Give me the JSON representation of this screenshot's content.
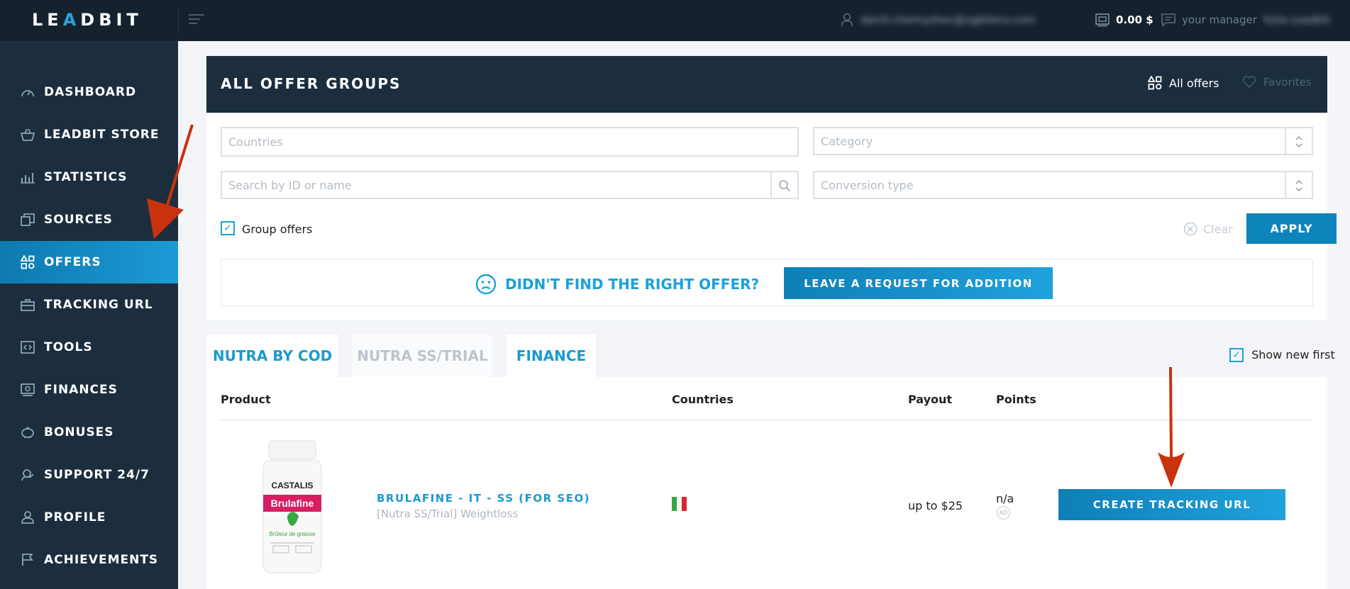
{
  "topbar": {
    "logo_left": "LE",
    "logo_accent": "A",
    "logo_right": "DBIT",
    "user_email": "daniil.chernyshev@xgbilenv.com",
    "balance": "0.00 $",
    "manager_label": "your manager",
    "manager_name": "Yulia Leadbit"
  },
  "sidebar": {
    "items": [
      {
        "label": "DASHBOARD",
        "icon": "gauge-icon"
      },
      {
        "label": "LEADBIT STORE",
        "icon": "basket-icon"
      },
      {
        "label": "STATISTICS",
        "icon": "bar-chart-icon"
      },
      {
        "label": "SOURCES",
        "icon": "layers-icon"
      },
      {
        "label": "OFFERS",
        "icon": "offers-icon"
      },
      {
        "label": "TRACKING URL",
        "icon": "briefcase-icon"
      },
      {
        "label": "TOOLS",
        "icon": "code-icon"
      },
      {
        "label": "FINANCES",
        "icon": "money-icon"
      },
      {
        "label": "BONUSES",
        "icon": "piggy-bank-icon"
      },
      {
        "label": "SUPPORT 24/7",
        "icon": "support-icon"
      },
      {
        "label": "PROFILE",
        "icon": "user-icon"
      },
      {
        "label": "ACHIEVEMENTS",
        "icon": "flag-icon"
      }
    ],
    "active_index": 4
  },
  "panel": {
    "title": "ALL OFFER GROUPS",
    "all_offers": "All offers",
    "favorites": "Favorites"
  },
  "filters": {
    "countries_placeholder": "Countries",
    "category_placeholder": "Category",
    "search_placeholder": "Search by ID or name",
    "conversion_placeholder": "Conversion type",
    "group_offers_label": "Group offers",
    "group_offers_checked": true,
    "clear_label": "Clear",
    "apply_label": "APPLY"
  },
  "notfound": {
    "text": "DIDN'T FIND THE RIGHT OFFER?",
    "button": "LEAVE A REQUEST FOR ADDITION"
  },
  "tabs": [
    {
      "label": "NUTRA BY COD",
      "active": true
    },
    {
      "label": "NUTRA SS/TRIAL",
      "active": false
    },
    {
      "label": "FINANCE",
      "active": true
    }
  ],
  "show_new_first": {
    "label": "Show new first",
    "checked": true
  },
  "table": {
    "headers": {
      "product": "Product",
      "countries": "Countries",
      "payout": "Payout",
      "points": "Points"
    },
    "rows": [
      {
        "name": "BRULAFINE - IT - SS (FOR SEO)",
        "category": "[Nutra SS/Trial] Weightloss",
        "country_flag": "IT",
        "payout": "up to $25",
        "points": "n/a",
        "points_icon_text": "AD",
        "button": "CREATE TRACKING URL",
        "product_image": {
          "brand": "CASTALIS",
          "label": "Brulafine",
          "tagline": "Brûleur de graisse"
        }
      }
    ]
  },
  "colors": {
    "accent": "#1aa2d6",
    "dark": "#1c2e3d",
    "arrow": "#c9320e"
  }
}
